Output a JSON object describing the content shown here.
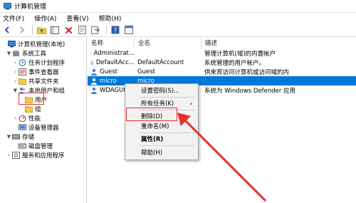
{
  "window": {
    "title": "计算机管理"
  },
  "menu": [
    "文件(F)",
    "操作(A)",
    "查看(V)",
    "帮助(H)"
  ],
  "toolbar": [
    "back-icon",
    "forward-icon",
    "folder-up-icon",
    "show-hide-tree-icon",
    "delete-icon",
    "properties-icon",
    "export-icon",
    "refresh-icon",
    "help-icon",
    "console-icon"
  ],
  "tree": {
    "root": "计算机管理(本地)",
    "system_tools": "系统工具",
    "task_scheduler": "任务计划程序",
    "event_viewer": "事件查看器",
    "shared_folders": "共享文件夹",
    "local_users_groups": "本地用户和组",
    "users": "用户",
    "groups": "组",
    "performance": "性能",
    "device_manager": "设备管理器",
    "storage": "存储",
    "disk_management": "磁盘管理",
    "services_apps": "服务和应用程序"
  },
  "columns": {
    "name": "名称",
    "fullname": "全名",
    "description": "描述"
  },
  "users": [
    {
      "name": "Administrat...",
      "fullname": "",
      "description": "管理计算机(域)的内置帐户"
    },
    {
      "name": "DefaultAcc...",
      "fullname": "DefaultAccount",
      "description": "系统管理的用户帐户。"
    },
    {
      "name": "Guest",
      "fullname": "Guest",
      "description": "供来宾访问计算机或访问域的内"
    },
    {
      "name": "micro",
      "fullname": "micro",
      "description": ""
    },
    {
      "name": "WDAGUti",
      "fullname": "",
      "description": "系统为 Windows Defender 应用"
    }
  ],
  "context_menu": {
    "set_password": "设置密码(S)...",
    "all_tasks": "所有任务(K)",
    "delete": "删除(D)",
    "rename": "重命名(M)",
    "properties": "属性(R)",
    "help": "帮助(H)"
  },
  "colors": {
    "selection": "#0078d7",
    "annotation": "#e2312d"
  }
}
